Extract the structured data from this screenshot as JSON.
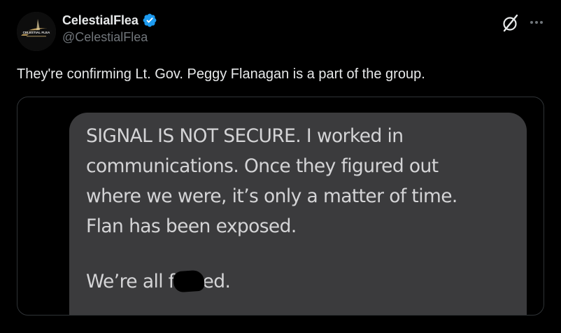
{
  "author": {
    "display_name": "CelestialFlea",
    "handle": "@CelestialFlea",
    "verified": true,
    "avatar_label": "CELESTIAL FLEA"
  },
  "actions": {
    "grok_icon": "grok-icon",
    "more_icon": "more-icon"
  },
  "tweet": {
    "text": "They're confirming Lt. Gov. Peggy Flanagan is a part of the group."
  },
  "media": {
    "message_body": "SIGNAL IS NOT SECURE. I worked in\ncommunications. Once they figured out\nwhere we were, it’s only a matter of time.\nFlan has been exposed.",
    "last_line_prefix": "We’re all f",
    "last_line_suffix": "ed."
  },
  "colors": {
    "background": "#000000",
    "text_primary": "#e7e9ea",
    "text_secondary": "#71767b",
    "verified_blue": "#1d9bf0",
    "bubble": "#3b3b3d",
    "border": "#2f3336"
  }
}
